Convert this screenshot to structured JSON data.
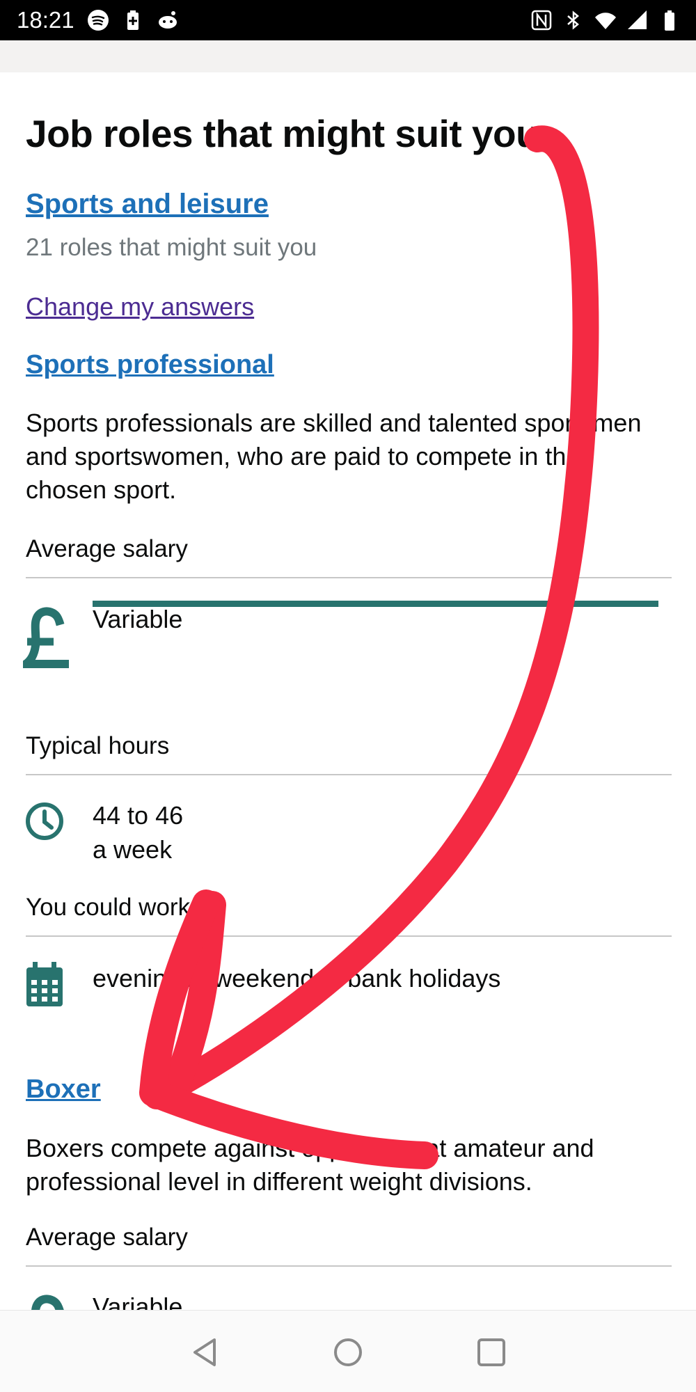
{
  "status_bar": {
    "time": "18:21",
    "left_icons": [
      "spotify-icon",
      "battery-saver-icon",
      "reddit-icon"
    ],
    "right_icons": [
      "nfc-icon",
      "bluetooth-icon",
      "wifi-icon",
      "signal-icon",
      "battery-icon"
    ]
  },
  "page": {
    "title": "Job roles that might suit you",
    "category_link": "Sports and leisure",
    "category_subtitle": "21 roles that might suit you",
    "change_answers_link": "Change my answers"
  },
  "roles": [
    {
      "name": "Sports professional",
      "description": "Sports professionals are skilled and talented sportsmen and sportswomen, who are paid to compete in their chosen sport.",
      "salary_label": "Average salary",
      "salary_value": "Variable",
      "hours_label": "Typical hours",
      "hours_value_line1": "44 to 46",
      "hours_value_line2": "a week",
      "work_label": "You could work",
      "work_value": "evenings / weekends / bank holidays"
    },
    {
      "name": "Boxer",
      "description": "Boxers compete against opponents at amateur and professional level in different weight divisions.",
      "salary_label": "Average salary",
      "salary_value": "Variable"
    }
  ],
  "colors": {
    "link": "#1d70b8",
    "visited_link": "#4c2c92",
    "accent_teal": "#28736e",
    "annotation_red": "#f42a43"
  },
  "nav": {
    "buttons": [
      "back-icon",
      "home-icon",
      "recents-icon"
    ]
  }
}
